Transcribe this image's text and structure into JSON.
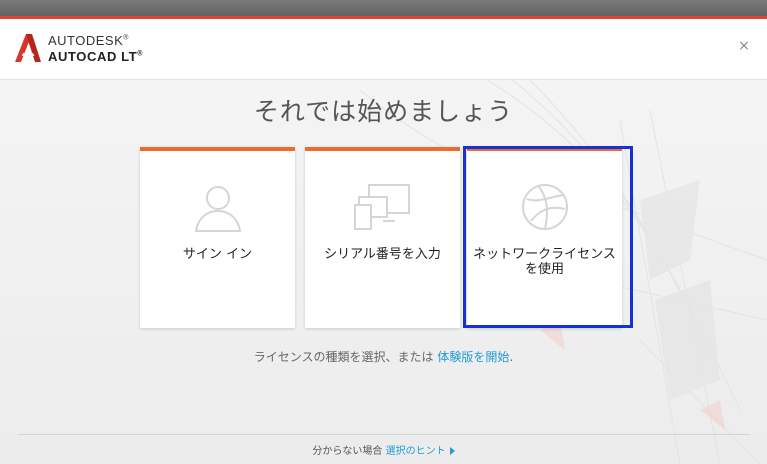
{
  "app": {
    "brand_line1": "AUTODESK",
    "brand_mark": "®",
    "brand_line2": "AUTOCAD LT",
    "brand_trademark": "®",
    "close_glyph": "×"
  },
  "main": {
    "title": "それでは始めましょう",
    "cards": [
      {
        "label": "サイン イン",
        "icon": "user-icon"
      },
      {
        "label": "シリアル番号を入力",
        "icon": "devices-icon"
      },
      {
        "label": "ネットワークライセンスを使用",
        "icon": "globe-icon",
        "selected": true
      }
    ],
    "license_text": "ライセンスの種類を選択、または",
    "trial_link": "体験版を開始",
    "trial_link_suffix": "."
  },
  "footer": {
    "hint_prefix": "分からない場合",
    "hint_link": "選択のヒント"
  },
  "colors": {
    "accent": "#ee6a2d",
    "link": "#1f9bd7",
    "highlight": "#1432d6",
    "topbar_accent": "#e0413b"
  }
}
